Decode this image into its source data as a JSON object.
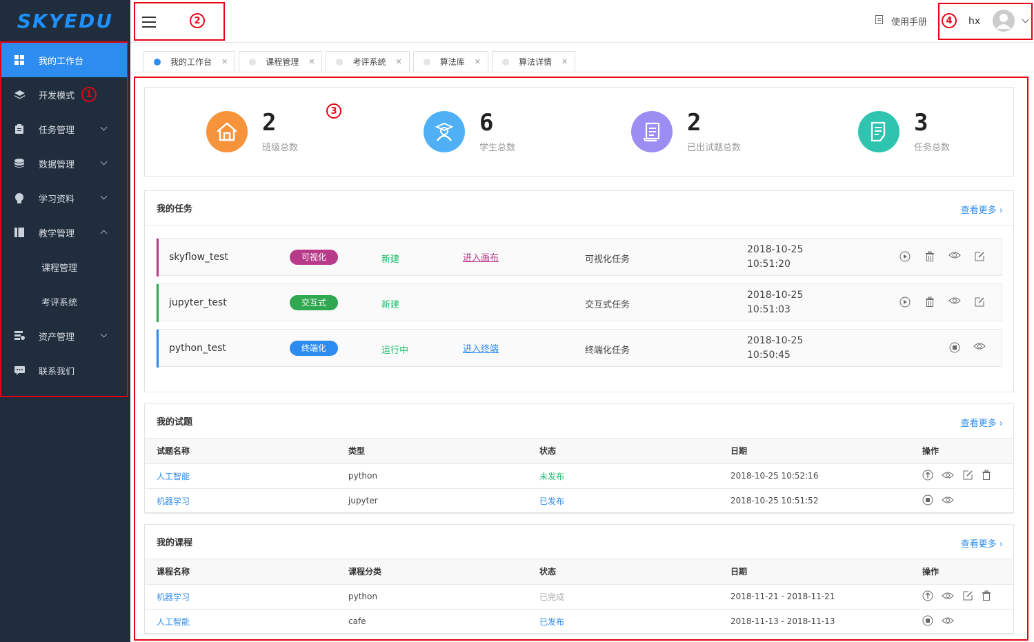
{
  "app": {
    "logo": "SKYEDU"
  },
  "annotations": {
    "n1": "1",
    "n2": "2",
    "n3": "3",
    "n4": "4"
  },
  "sidebar": {
    "items": [
      {
        "label": "我的工作台",
        "icon": "grid-icon"
      },
      {
        "label": "开发模式",
        "icon": "layers-icon"
      },
      {
        "label": "任务管理",
        "icon": "clipboard-icon"
      },
      {
        "label": "数据管理",
        "icon": "database-icon"
      },
      {
        "label": "学习资料",
        "icon": "bulb-icon"
      },
      {
        "label": "教学管理",
        "icon": "book-icon"
      },
      {
        "label": "课程管理"
      },
      {
        "label": "考评系统"
      },
      {
        "label": "资产管理",
        "icon": "asset-icon"
      },
      {
        "label": "联系我们",
        "icon": "chat-icon"
      }
    ]
  },
  "header": {
    "manual": "使用手册",
    "user": "hx"
  },
  "tabs": [
    "我的工作台",
    "课程管理",
    "考评系统",
    "算法库",
    "算法详情"
  ],
  "stats": [
    {
      "value": "2",
      "label": "班级总数",
      "color": "#f7933a"
    },
    {
      "value": "6",
      "label": "学生总数",
      "color": "#4fb0f5"
    },
    {
      "value": "2",
      "label": "已出试题总数",
      "color": "#9b8df2"
    },
    {
      "value": "3",
      "label": "任务总数",
      "color": "#2ec4b0"
    }
  ],
  "tasks": {
    "title": "我的任务",
    "more": "查看更多 ›",
    "rows": [
      {
        "name": "skyflow_test",
        "badge": "可视化",
        "badge_color": "#b83b8a",
        "status": "新建",
        "link": "进入画布",
        "type": "可视化任务",
        "date": "2018-10-25",
        "time": "10:51:20"
      },
      {
        "name": "jupyter_test",
        "badge": "交互式",
        "badge_color": "#30a851",
        "status": "新建",
        "link": "",
        "type": "交互式任务",
        "date": "2018-10-25",
        "time": "10:51:03"
      },
      {
        "name": "python_test",
        "badge": "终端化",
        "badge_color": "#2d8cf0",
        "status": "运行中",
        "link": "进入终端",
        "type": "终端化任务",
        "date": "2018-10-25",
        "time": "10:50:45"
      }
    ]
  },
  "exams": {
    "title": "我的试题",
    "more": "查看更多 ›",
    "headers": [
      "试题名称",
      "类型",
      "状态",
      "日期",
      "操作"
    ],
    "rows": [
      {
        "name": "人工智能",
        "type": "python",
        "status": "未发布",
        "date": "2018-10-25 10:52:16"
      },
      {
        "name": "机器学习",
        "type": "jupyter",
        "status": "已发布",
        "date": "2018-10-25 10:51:52"
      }
    ]
  },
  "courses": {
    "title": "我的课程",
    "more": "查看更多 ›",
    "headers": [
      "课程名称",
      "课程分类",
      "状态",
      "日期",
      "操作"
    ],
    "rows": [
      {
        "name": "机器学习",
        "type": "python",
        "status": "已完成",
        "date": "2018-11-21 - 2018-11-21"
      },
      {
        "name": "人工智能",
        "type": "cafe",
        "status": "已发布",
        "date": "2018-11-13 - 2018-11-13"
      }
    ]
  }
}
